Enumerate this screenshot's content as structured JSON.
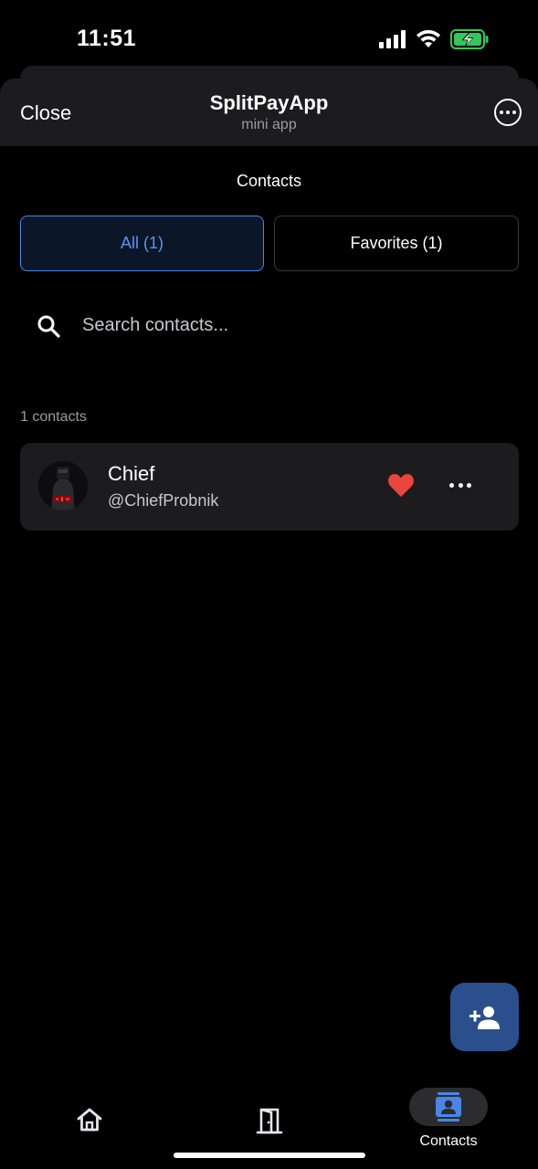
{
  "status_bar": {
    "time": "11:51",
    "battery_state": "charging"
  },
  "header": {
    "close_label": "Close",
    "title": "SplitPayApp",
    "subtitle": "mini app"
  },
  "page": {
    "title": "Contacts"
  },
  "tabs": [
    {
      "label": "All (1)",
      "active": true
    },
    {
      "label": "Favorites (1)",
      "active": false
    }
  ],
  "search": {
    "placeholder": "Search contacts...",
    "value": ""
  },
  "contacts": {
    "count_label": "1 contacts",
    "items": [
      {
        "name": "Chief",
        "handle": "@ChiefProbnik",
        "favorite": true
      }
    ]
  },
  "bottom_nav": {
    "items": [
      {
        "icon": "home-icon",
        "label": ""
      },
      {
        "icon": "door-icon",
        "label": ""
      },
      {
        "icon": "contacts-icon",
        "label": "Contacts",
        "active": true
      }
    ]
  },
  "colors": {
    "accent": "#5b95f0",
    "favorite": "#e8453c",
    "fab": "#2b4f8c",
    "battery": "#34c759",
    "card": "#1c1c1e"
  }
}
